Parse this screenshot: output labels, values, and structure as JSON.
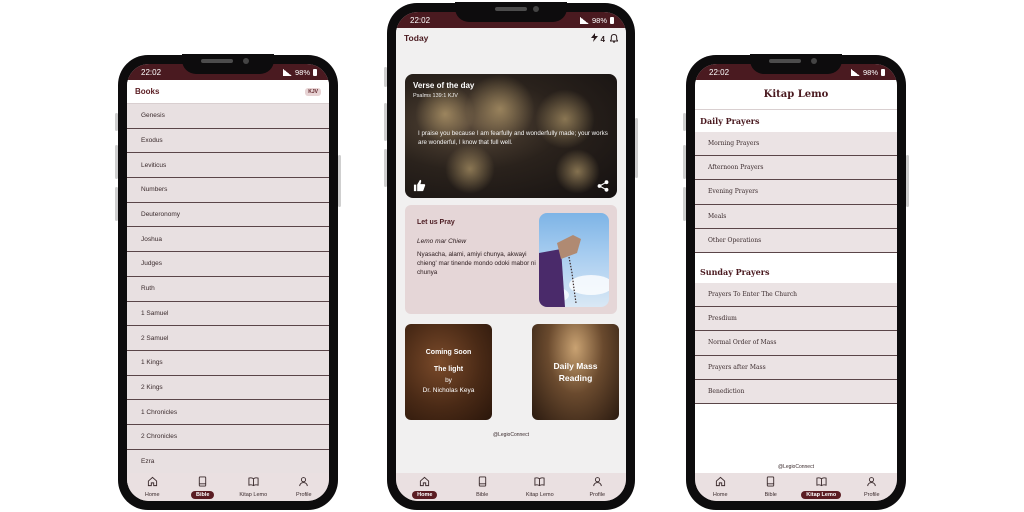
{
  "status": {
    "time": "22:02",
    "battery": "98%"
  },
  "tabs": [
    "Home",
    "Bible",
    "Kitap Lemo",
    "Profile"
  ],
  "bible_screen": {
    "title": "Books",
    "version_badge": "KJV",
    "books": [
      "Genesis",
      "Exodus",
      "Leviticus",
      "Numbers",
      "Deuteronomy",
      "Joshua",
      "Judges",
      "Ruth",
      "1 Samuel",
      "2 Samuel",
      "1 Kings",
      "2 Kings",
      "1 Chronicles",
      "2 Chronicles",
      "Ezra"
    ],
    "active_tab": "Bible"
  },
  "home_screen": {
    "title": "Today",
    "streak_count": "4",
    "verse": {
      "title": "Verse of the day",
      "reference": "Psalms 139:1 KJV",
      "text": "I praise you because I am fearfully and wonderfully made; your works are wonderful, I know that full well."
    },
    "prayer": {
      "title": "Let us Pray",
      "subtitle": "Lemo mar Chiew",
      "text": "Nyasacha, alami, amiyi chunya, akwayi chieng' mar tinende mondo odoki mabor ni chunya"
    },
    "coming_soon": {
      "heading": "Coming Soon",
      "book_title": "The light",
      "by": "by",
      "author": "Dr. Nicholas Keya"
    },
    "daily_mass": {
      "line1": "Daily Mass",
      "line2": "Reading"
    },
    "copyright": "@LegioConnect",
    "active_tab": "Home"
  },
  "kitap_screen": {
    "title": "Kitap Lemo",
    "sections": [
      {
        "heading": "Daily Prayers",
        "items": [
          "Morning Prayers",
          "Afternoon Prayers",
          "Evening Prayers",
          "Meals",
          "Other Operations"
        ]
      },
      {
        "heading": "Sunday Prayers",
        "items": [
          "Prayers To Enter The Church",
          "Presdium",
          "Normal Order of Mass",
          "Prayers after Mass",
          "Benediction"
        ]
      }
    ],
    "copyright": "@LegioConnect",
    "active_tab": "Kitap Lemo"
  },
  "colors": {
    "brand": "#5a1c22",
    "status_bar": "#4a1a20",
    "list_bg": "#e8e0e1",
    "card_bg": "#e5d6d7"
  }
}
